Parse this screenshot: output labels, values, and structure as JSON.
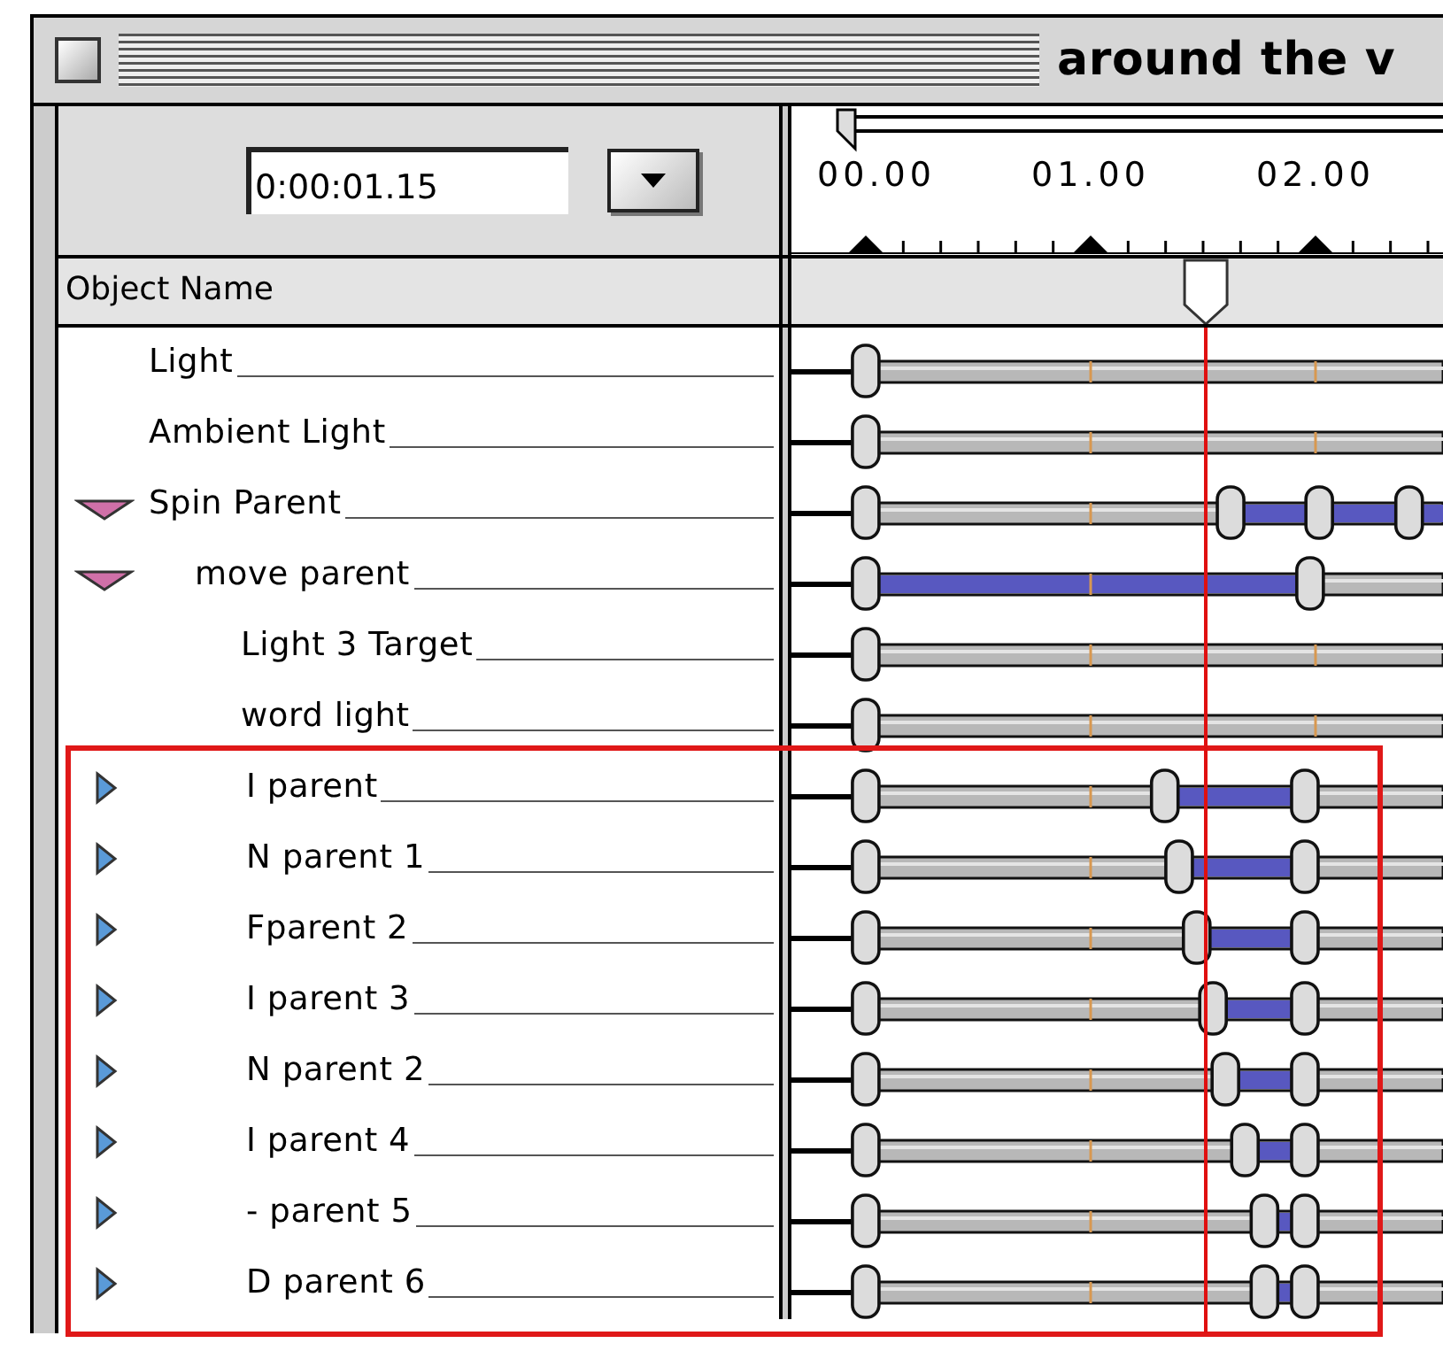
{
  "window": {
    "title": "around the v"
  },
  "header": {
    "current_time": "0:00:01.15",
    "column_title": "Object Name"
  },
  "timeline": {
    "ruler_labels": [
      "00.00",
      "01.00",
      "02.00"
    ],
    "playhead": {
      "level": 0.636
    }
  },
  "objects": [
    {
      "name": "Light",
      "highlighted": false,
      "keyframes": [
        {
          "level": 0.114,
          "animated_after": false
        }
      ]
    },
    {
      "name": "Ambient Light",
      "highlighted": false,
      "keyframes": [
        {
          "level": 0.114,
          "animated_after": false
        }
      ]
    },
    {
      "name": "Spin Parent",
      "expanded": true,
      "highlighted": false,
      "keyframes": [
        {
          "level": 0.114,
          "animated_after": false
        },
        {
          "level": 0.674,
          "animated_after": true
        },
        {
          "level": 0.81,
          "animated_after": true
        },
        {
          "level": 0.948,
          "animated_after": true
        }
      ],
      "children": [
        {
          "name": "move parent",
          "expanded": true,
          "highlighted": false,
          "keyframes": [
            {
              "level": 0.114,
              "animated_after": true
            },
            {
              "level": 0.796,
              "animated_after": false
            }
          ],
          "children": [
            {
              "name": "Light 3 Target",
              "highlighted": false,
              "keyframes": [
                {
                  "level": 0.114,
                  "animated_after": false
                }
              ]
            },
            {
              "name": "word light",
              "highlighted": false,
              "keyframes": [
                {
                  "level": 0.114,
                  "animated_after": false
                }
              ]
            },
            {
              "name": "I parent",
              "expanded": false,
              "highlighted": true,
              "keyframes": [
                {
                  "level": 0.114,
                  "animated_after": false
                },
                {
                  "level": 0.573,
                  "animated_after": true
                },
                {
                  "level": 0.788,
                  "animated_after": false
                }
              ]
            },
            {
              "name": "N parent 1",
              "expanded": false,
              "highlighted": true,
              "keyframes": [
                {
                  "level": 0.114,
                  "animated_after": false
                },
                {
                  "level": 0.595,
                  "animated_after": true
                },
                {
                  "level": 0.788,
                  "animated_after": false
                }
              ]
            },
            {
              "name": "Fparent 2",
              "expanded": false,
              "highlighted": true,
              "keyframes": [
                {
                  "level": 0.114,
                  "animated_after": false
                },
                {
                  "level": 0.622,
                  "animated_after": true
                },
                {
                  "level": 0.788,
                  "animated_after": false
                }
              ]
            },
            {
              "name": "I parent 3",
              "expanded": false,
              "highlighted": true,
              "keyframes": [
                {
                  "level": 0.114,
                  "animated_after": false
                },
                {
                  "level": 0.647,
                  "animated_after": true
                },
                {
                  "level": 0.788,
                  "animated_after": false
                }
              ]
            },
            {
              "name": "N parent 2",
              "expanded": false,
              "highlighted": true,
              "keyframes": [
                {
                  "level": 0.114,
                  "animated_after": false
                },
                {
                  "level": 0.666,
                  "animated_after": true
                },
                {
                  "level": 0.788,
                  "animated_after": false
                }
              ]
            },
            {
              "name": "I parent 4",
              "expanded": false,
              "highlighted": true,
              "keyframes": [
                {
                  "level": 0.114,
                  "animated_after": false
                },
                {
                  "level": 0.696,
                  "animated_after": true
                },
                {
                  "level": 0.788,
                  "animated_after": false
                }
              ]
            },
            {
              "name": "- parent 5",
              "expanded": false,
              "highlighted": true,
              "keyframes": [
                {
                  "level": 0.114,
                  "animated_after": false
                },
                {
                  "level": 0.726,
                  "animated_after": true
                },
                {
                  "level": 0.788,
                  "animated_after": false
                }
              ]
            },
            {
              "name": "D parent 6",
              "expanded": false,
              "highlighted": true,
              "keyframes": [
                {
                  "level": 0.114,
                  "animated_after": false
                },
                {
                  "level": 0.726,
                  "animated_after": true
                },
                {
                  "level": 0.788,
                  "animated_after": false
                }
              ]
            }
          ]
        }
      ]
    }
  ]
}
